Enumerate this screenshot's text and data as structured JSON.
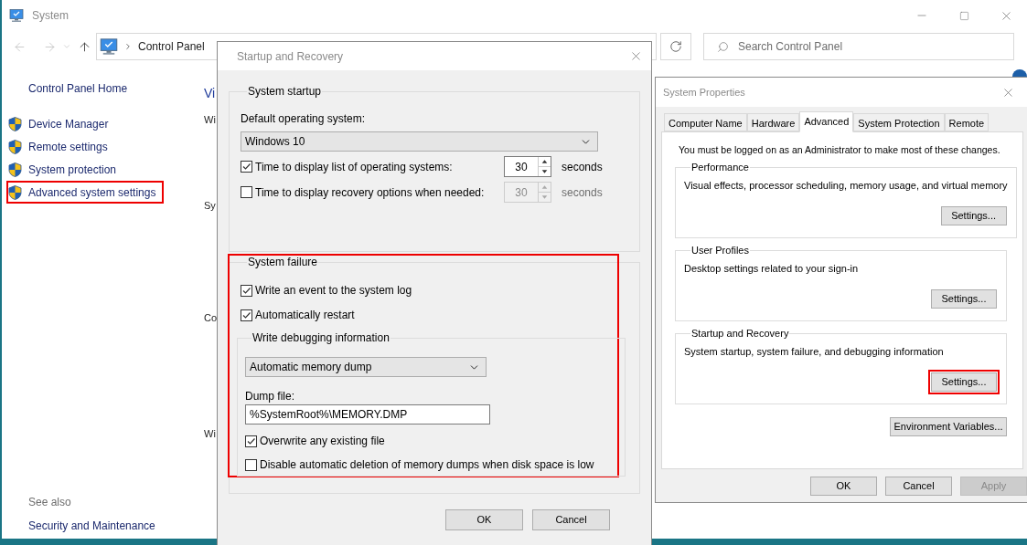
{
  "system_window": {
    "title": "System",
    "breadcrumb": [
      "Control Panel"
    ],
    "search_placeholder": "Search Control Panel",
    "sidebar": {
      "home": "Control Panel Home",
      "tasks": [
        {
          "label": "Device Manager",
          "highlighted": false
        },
        {
          "label": "Remote settings",
          "highlighted": false
        },
        {
          "label": "System protection",
          "highlighted": false
        },
        {
          "label": "Advanced system settings",
          "highlighted": true
        }
      ],
      "see_also": "See also",
      "links": [
        "Security and Maintenance"
      ]
    },
    "content_fragments": [
      {
        "kind": "heading",
        "text": "Vi"
      },
      {
        "kind": "text",
        "text": "Wi"
      },
      {
        "kind": "text",
        "text": "Sy"
      },
      {
        "kind": "text",
        "text": "Co"
      },
      {
        "kind": "text",
        "text": "Wi"
      }
    ]
  },
  "startup_dialog": {
    "title": "Startup and Recovery",
    "system_startup": {
      "title": "System startup",
      "default_os_label": "Default operating system:",
      "default_os": "Windows 10",
      "timers": [
        {
          "label": "Time to display list of operating systems:",
          "checked": true,
          "value": "30",
          "unit": "seconds"
        },
        {
          "label": "Time to display recovery options when needed:",
          "checked": false,
          "value": "30",
          "unit": "seconds"
        }
      ]
    },
    "system_failure": {
      "title": "System failure",
      "highlighted": true,
      "options": [
        {
          "label": "Write an event to the system log",
          "checked": true
        },
        {
          "label": "Automatically restart",
          "checked": true
        }
      ],
      "debugging": {
        "title": "Write debugging information",
        "dump_type": "Automatic memory dump",
        "dump_file_label": "Dump file:",
        "dump_file": "%SystemRoot%\\MEMORY.DMP",
        "options": [
          {
            "label": "Overwrite any existing file",
            "checked": true
          },
          {
            "label": "Disable automatic deletion of memory dumps when disk space is low",
            "checked": false
          }
        ]
      }
    },
    "buttons": [
      {
        "label": "OK",
        "disabled": false
      },
      {
        "label": "Cancel",
        "disabled": false
      }
    ]
  },
  "properties_dialog": {
    "title": "System Properties",
    "tabs": [
      {
        "label": "Computer Name",
        "selected": false
      },
      {
        "label": "Hardware",
        "selected": false
      },
      {
        "label": "Advanced",
        "selected": true
      },
      {
        "label": "System Protection",
        "selected": false
      },
      {
        "label": "Remote",
        "selected": false
      }
    ],
    "notice": "You must be logged on as an Administrator to make most of these changes.",
    "groups": [
      {
        "title": "Performance",
        "description": "Visual effects, processor scheduling, memory usage, and virtual memory",
        "button": "Settings...",
        "highlighted": false
      },
      {
        "title": "User Profiles",
        "description": "Desktop settings related to your sign-in",
        "button": "Settings...",
        "highlighted": false
      },
      {
        "title": "Startup and Recovery",
        "description": "System startup, system failure, and debugging information",
        "button": "Settings...",
        "highlighted": true
      }
    ],
    "env_button": "Environment Variables...",
    "buttons": [
      {
        "label": "OK",
        "disabled": false
      },
      {
        "label": "Cancel",
        "disabled": false
      },
      {
        "label": "Apply",
        "disabled": true
      }
    ]
  }
}
